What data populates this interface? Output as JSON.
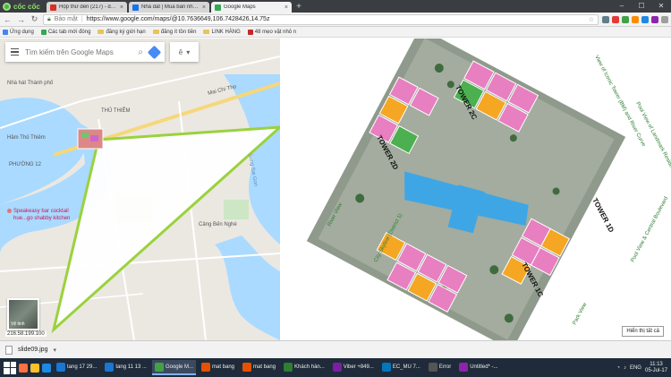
{
  "browser": {
    "brand": "cốc cốc",
    "tabs": [
      {
        "title": "Hộp thư đến (217) - ducp",
        "color": "#d93025",
        "active": false
      },
      {
        "title": "Nhà đất | Mua bán nhà đất",
        "color": "#1a73e8",
        "active": false
      },
      {
        "title": "Google Maps",
        "color": "#34a853",
        "active": true
      }
    ],
    "omnibox": {
      "secure_label": "Bảo mật",
      "url": "https://www.google.com/maps/@10.7636649,106.7428426,14.75z"
    },
    "bookmarks": [
      {
        "label": "Ứng dụng",
        "icon": "apps-icon",
        "color": "#4285f4"
      },
      {
        "label": "Các tab mới đóng",
        "icon": "history-icon",
        "color": "#34a853"
      },
      {
        "label": "đăng ký giới hạn",
        "icon": "folder-icon",
        "color": "#e8c45a"
      },
      {
        "label": "đăng ít tồn tiền",
        "icon": "folder-icon",
        "color": "#e8c45a"
      },
      {
        "label": "LINK HÀNG",
        "icon": "folder-icon",
        "color": "#e8c45a"
      },
      {
        "label": "48 mẹo vặt nhỏ n",
        "icon": "bookmark-icon",
        "color": "#c62828"
      }
    ]
  },
  "map": {
    "search_placeholder": "Tìm kiếm trên Google Maps",
    "dropdown_label": "ê",
    "labels": [
      {
        "text": "Nhà hát Thành phố"
      },
      {
        "text": "THỦ THIÊM"
      },
      {
        "text": "PHƯỜNG 12"
      },
      {
        "text": "Hầm Thủ Thiêm"
      },
      {
        "text": "Mai Chí Thọ"
      },
      {
        "text": "Cảng Bến Nghé"
      },
      {
        "text": "Song Sai Gon"
      }
    ],
    "pois": [
      {
        "text": "Speakeasy bar cocktail"
      },
      {
        "text": "hue...go shabby kitchen"
      }
    ],
    "satellite_label": "Vệ tinh",
    "coords": "216.58.199.100"
  },
  "plan": {
    "towers": [
      "TOWER 2C",
      "TOWER 2D",
      "TOWER 1D",
      "TOWER 1C"
    ],
    "views": [
      "River View",
      "City Skyline (District 1)",
      "View of Iconic Tower (BM) and River Curve",
      "Pool View of Landmark Residences (Level 5)",
      "Pool View & Central Boulevard",
      "Park View"
    ],
    "tooltip": "Hiển thị tất cả"
  },
  "download": {
    "filename": "slide09.jpg"
  },
  "taskbar": {
    "apps": [
      {
        "label": "tang 17 29...",
        "color": "#1976d2"
      },
      {
        "label": "tang 11 13 ...",
        "color": "#1976d2"
      },
      {
        "label": "Google M...",
        "color": "#43a047",
        "active": true
      },
      {
        "label": "mat bang",
        "color": "#e65100"
      },
      {
        "label": "mat bang",
        "color": "#e65100"
      },
      {
        "label": "Khách hàn...",
        "color": "#2e7d32"
      },
      {
        "label": "Viber +849...",
        "color": "#7b1fa2"
      },
      {
        "label": "EC_MU 7...",
        "color": "#0277bd"
      },
      {
        "label": "Error",
        "color": "#555"
      },
      {
        "label": "Untitled* -...",
        "color": "#8e24aa"
      }
    ],
    "language": "ENG",
    "time": "11:13",
    "date": "05-Jul-17"
  }
}
